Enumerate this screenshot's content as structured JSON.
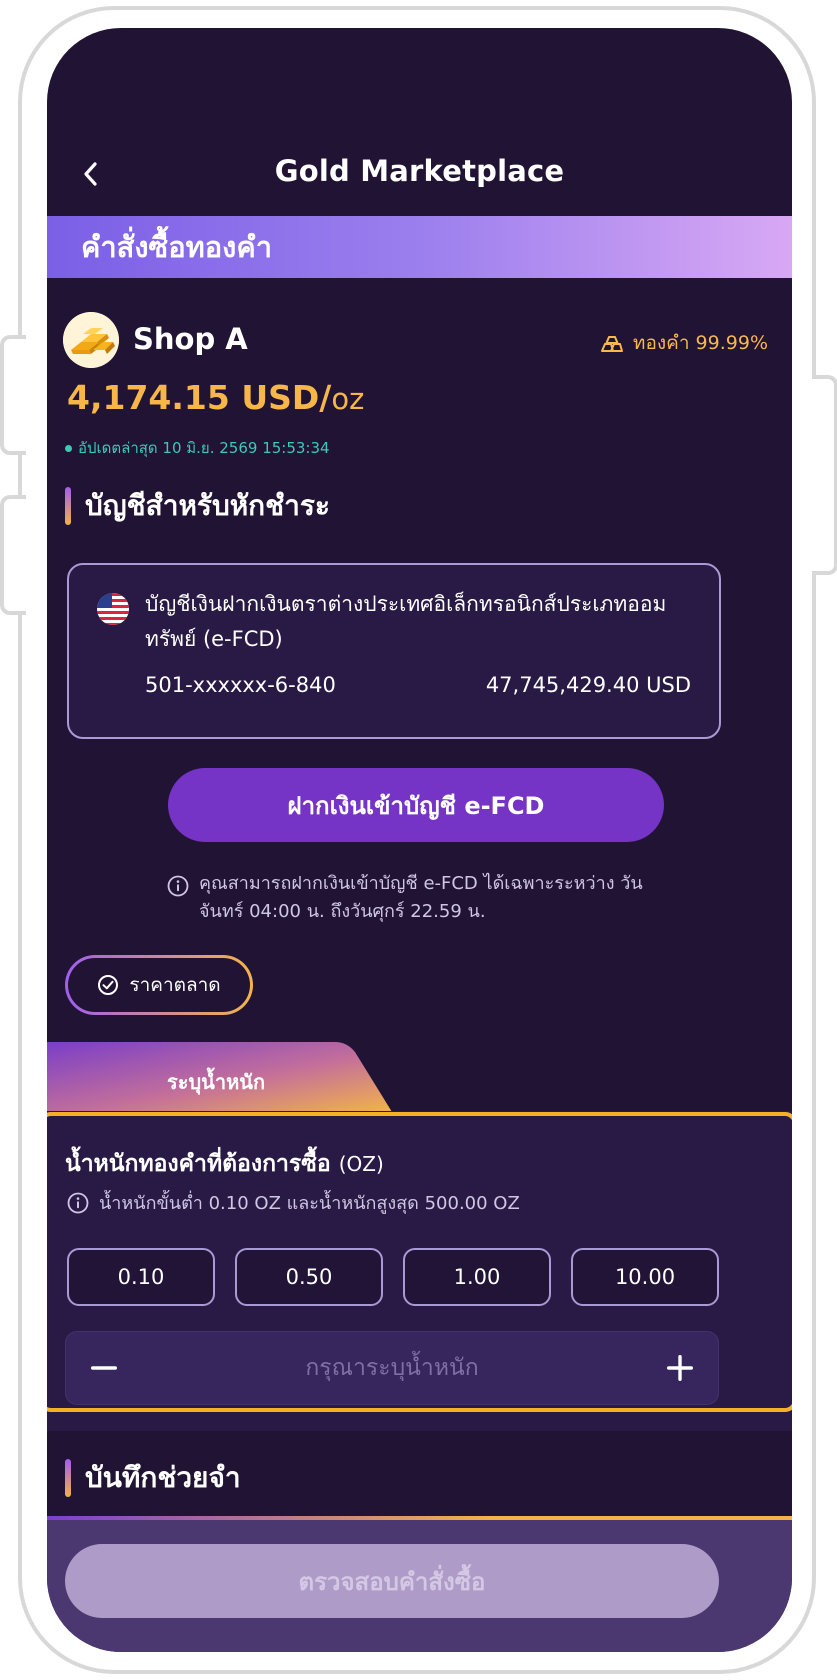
{
  "header": {
    "title": "Gold Marketplace",
    "back_icon": "chevron-left-icon"
  },
  "banner": {
    "title": "คำสั่งซื้อทองคำ"
  },
  "shop": {
    "name": "Shop A",
    "logo_icon": "gold-bars-icon",
    "purity": "ทองคำ 99.99%",
    "purity_icon": "gold-bar-stack-icon",
    "price_value": "4,174.15 USD/",
    "price_unit": "oz",
    "last_updated": "อัปเดตล่าสุด 10 มิ.ย. 2569 15:53:34"
  },
  "payment": {
    "section_title": "บัญชีสำหรับหักชำระ",
    "account": {
      "flag_icon": "us-flag-icon",
      "name": "บัญชีเงินฝากเงินตราต่างประเทศอิเล็กทรอนิกส์ประเภทออมทรัพย์ (e-FCD)",
      "number": "501-xxxxxx-6-840",
      "balance": "47,745,429.40 USD"
    },
    "deposit_button": "ฝากเงินเข้าบัญชี e-FCD",
    "deposit_note": "คุณสามารถฝากเงินเข้าบัญชี e-FCD ได้เฉพาะระหว่าง วันจันทร์ 04:00 น. ถึงวันศุกร์ 22.59 น."
  },
  "order_type": {
    "market_price_label": "ราคาตลาด",
    "tab_label": "ระบุน้ำหนัก"
  },
  "weight": {
    "title": "น้ำหนักทองคำที่ต้องการซื้อ",
    "title_unit": "(OZ)",
    "hint": "น้ำหนักขั้นต่ำ 0.10 OZ และน้ำหนักสูงสุด 500.00 OZ",
    "presets": [
      "0.10",
      "0.50",
      "1.00",
      "10.00"
    ],
    "input_placeholder": "กรุณาระบุน้ำหนัก",
    "input_value": ""
  },
  "notes": {
    "section_title": "บันทึกช่วยจำ"
  },
  "footer": {
    "confirm_button": "ตรวจสอบคำสั่งซื้อ"
  },
  "colors": {
    "background": "#201333",
    "accent_gold": "#f6b748",
    "primary_purple": "#7534c6",
    "timestamp_teal": "#3ec9b3",
    "highlight_border": "#f6b028"
  }
}
